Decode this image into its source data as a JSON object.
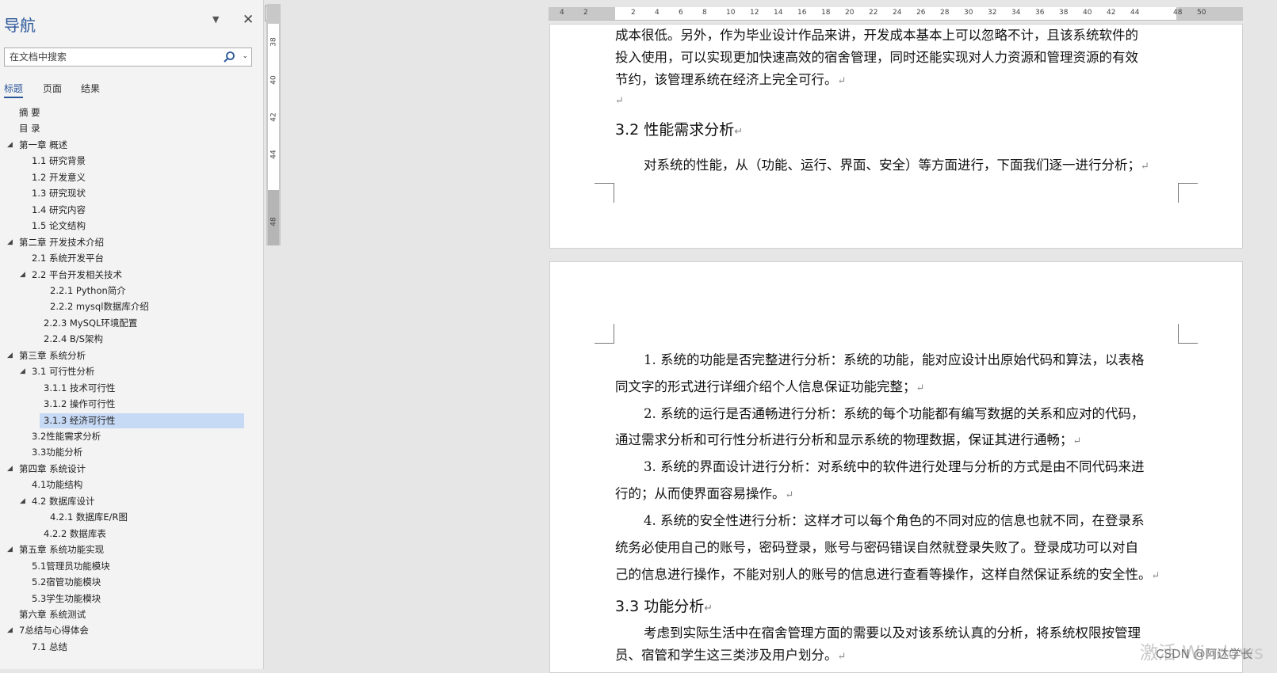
{
  "nav": {
    "title": "导航",
    "dropdown_icon": "▼",
    "close_icon": "✕",
    "search_placeholder": "在文档中搜索",
    "tabs": [
      "标题",
      "页面",
      "结果"
    ],
    "toc": [
      {
        "label": "摘  要",
        "level": 0,
        "tri": ""
      },
      {
        "label": "目  录",
        "level": 0,
        "tri": ""
      },
      {
        "label": "第一章  概述",
        "level": 0,
        "tri": "◢"
      },
      {
        "label": "1.1 研究背景",
        "level": 1,
        "tri": ""
      },
      {
        "label": "1.2 开发意义",
        "level": 1,
        "tri": ""
      },
      {
        "label": "1.3 研究现状",
        "level": 1,
        "tri": ""
      },
      {
        "label": "1.4 研究内容",
        "level": 1,
        "tri": ""
      },
      {
        "label": "1.5 论文结构",
        "level": 1,
        "tri": ""
      },
      {
        "label": "第二章  开发技术介绍",
        "level": 0,
        "tri": "◢"
      },
      {
        "label": "2.1 系统开发平台",
        "level": 1,
        "tri": ""
      },
      {
        "label": "2.2 平台开发相关技术",
        "level": 1,
        "tri": "◢"
      },
      {
        "label": "2.2.1   Python简介",
        "level": 3,
        "tri": ""
      },
      {
        "label": "2.2.2   mysql数据库介绍",
        "level": 3,
        "tri": ""
      },
      {
        "label": "2.2.3   MySQL环境配置",
        "level": 2,
        "tri": ""
      },
      {
        "label": "2.2.4   B/S架构",
        "level": 2,
        "tri": ""
      },
      {
        "label": "第三章  系统分析",
        "level": 0,
        "tri": "◢"
      },
      {
        "label": "3.1 可行性分析",
        "level": 1,
        "tri": "◢"
      },
      {
        "label": "3.1.1 技术可行性",
        "level": 2,
        "tri": ""
      },
      {
        "label": "3.1.2 操作可行性",
        "level": 2,
        "tri": ""
      },
      {
        "label": "3.1.3 经济可行性",
        "level": 2,
        "tri": "",
        "selected": true
      },
      {
        "label": "3.2性能需求分析",
        "level": 1,
        "tri": ""
      },
      {
        "label": "3.3功能分析",
        "level": 1,
        "tri": ""
      },
      {
        "label": "第四章  系统设计",
        "level": 0,
        "tri": "◢"
      },
      {
        "label": "4.1功能结构",
        "level": 1,
        "tri": ""
      },
      {
        "label": "4.2 数据库设计",
        "level": 1,
        "tri": "◢"
      },
      {
        "label": "4.2.1 数据库E/R图",
        "level": 3,
        "tri": ""
      },
      {
        "label": "4.2.2 数据库表",
        "level": 2,
        "tri": ""
      },
      {
        "label": "第五章  系统功能实现",
        "level": 0,
        "tri": "◢"
      },
      {
        "label": "5.1管理员功能模块",
        "level": 1,
        "tri": ""
      },
      {
        "label": "5.2宿管功能模块",
        "level": 1,
        "tri": ""
      },
      {
        "label": "5.3学生功能模块",
        "level": 1,
        "tri": ""
      },
      {
        "label": "第六章  系统测试",
        "level": 0,
        "tri": ""
      },
      {
        "label": "7总结与心得体会",
        "level": 0,
        "tri": "◢"
      },
      {
        "label": "7.1 总结",
        "level": 1,
        "tri": ""
      }
    ]
  },
  "vruler_labels": [
    "38",
    "40",
    "42",
    "44",
    "48"
  ],
  "ruler": {
    "corner": "L",
    "ticks": [
      "4",
      "2",
      "2",
      "4",
      "6",
      "8",
      "10",
      "12",
      "14",
      "16",
      "18",
      "20",
      "22",
      "24",
      "26",
      "28",
      "30",
      "32",
      "34",
      "36",
      "38",
      "40",
      "42",
      "44",
      "48",
      "50"
    ]
  },
  "doc": {
    "p1_line1": "成本很低。另外，作为毕业设计作品来讲，开发成本基本上可以忽略不计，且该系统软件的",
    "p1_line2": "投入使用，可以实现更加快速高效的宿舍管理，同时还能实现对人力资源和管理资源的有效",
    "p1_line3": "节约，该管理系统在经济上完全可行。",
    "h32": "3.2 性能需求分析",
    "p2": "对系统的性能，从（功能、运行、界面、安全）等方面进行，下面我们逐一进行分析；",
    "item1_a": "1.  系统的功能是否完整进行分析：系统的功能，能对应设计出原始代码和算法，以表格",
    "item1_b": "同文字的形式进行详细介绍个人信息保证功能完整；",
    "item2_a": "2.  系统的运行是否通畅进行分析：系统的每个功能都有编写数据的关系和应对的代码，",
    "item2_b": "通过需求分析和可行性分析进行分析和显示系统的物理数据，保证其进行通畅；",
    "item3_a": "3.  系统的界面设计进行分析：对系统中的软件进行处理与分析的方式是由不同代码来进",
    "item3_b": "行的；从而使界面容易操作。",
    "item4_a": "4.  系统的安全性进行分析：这样才可以每个角色的不同对应的信息也就不同，在登录系",
    "item4_b": "统务必使用自己的账号，密码登录，账号与密码错误自然就登录失败了。登录成功可以对自",
    "item4_c": "己的信息进行操作，不能对别人的账号的信息进行查看等操作，这样自然保证系统的安全性。",
    "h33": "3.3 功能分析",
    "p3_a": "考虑到实际生活中在宿舍管理方面的需要以及对该系统认真的分析，将系统权限按管理",
    "p3_b": "员、宿管和学生这三类涉及用户划分。",
    "pilcrow": "↵"
  },
  "overlay": {
    "watermark": "激活 Windows",
    "csdn": "CSDN @阿达学长"
  }
}
